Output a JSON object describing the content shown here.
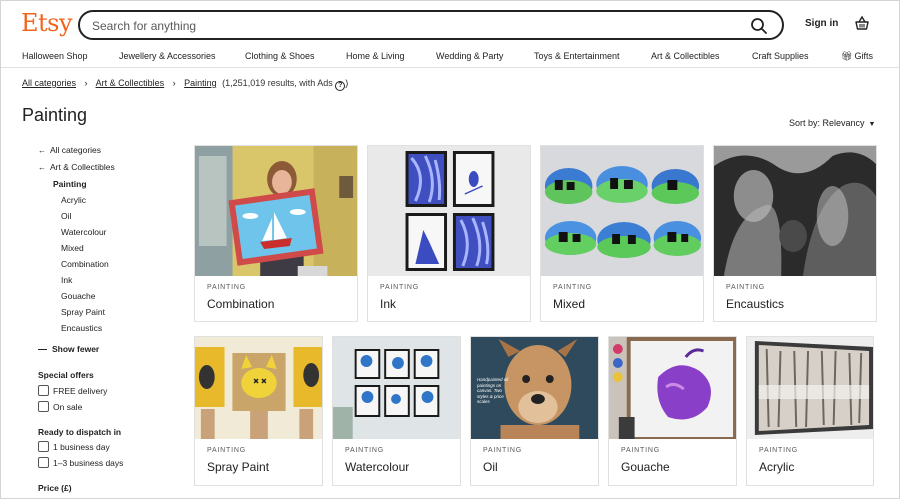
{
  "header": {
    "logo": "Etsy",
    "search_placeholder": "Search for anything",
    "sign_in": "Sign in"
  },
  "nav": [
    "Halloween Shop",
    "Jewellery & Accessories",
    "Clothing & Shoes",
    "Home & Living",
    "Wedding & Party",
    "Toys & Entertainment",
    "Art & Collectibles",
    "Craft Supplies",
    "Gifts"
  ],
  "breadcrumb": {
    "items": [
      "All categories",
      "Art & Collectibles",
      "Painting"
    ],
    "count": "(1,251,019 results, with Ads",
    "help": "?",
    "close": ")"
  },
  "page": {
    "title": "Painting",
    "sort_label": "Sort by: Relevancy"
  },
  "sidebar": {
    "parents": [
      "All categories",
      "Art & Collectibles"
    ],
    "current": "Painting",
    "children": [
      "Acrylic",
      "Oil",
      "Watercolour",
      "Mixed",
      "Combination",
      "Ink",
      "Gouache",
      "Spray Paint",
      "Encaustics"
    ],
    "show_fewer": "Show fewer",
    "special_offers": {
      "heading": "Special offers",
      "options": [
        "FREE delivery",
        "On sale"
      ]
    },
    "dispatch": {
      "heading": "Ready to dispatch in",
      "options": [
        "1 business day",
        "1–3 business days"
      ]
    },
    "price_heading": "Price (£)"
  },
  "cards": [
    {
      "kicker": "PAINTING",
      "title": "Combination"
    },
    {
      "kicker": "PAINTING",
      "title": "Ink"
    },
    {
      "kicker": "PAINTING",
      "title": "Mixed"
    },
    {
      "kicker": "PAINTING",
      "title": "Encaustics"
    },
    {
      "kicker": "PAINTING",
      "title": "Spray Paint"
    },
    {
      "kicker": "PAINTING",
      "title": "Watercolour"
    },
    {
      "kicker": "PAINTING",
      "title": "Oil"
    },
    {
      "kicker": "PAINTING",
      "title": "Gouache"
    },
    {
      "kicker": "PAINTING",
      "title": "Acrylic"
    }
  ],
  "card_image_text": {
    "oil": "Handpainted oil paintings on canvas. Two styles & price scales"
  },
  "colors": {
    "brand": "#f1641e",
    "text": "#222222"
  }
}
